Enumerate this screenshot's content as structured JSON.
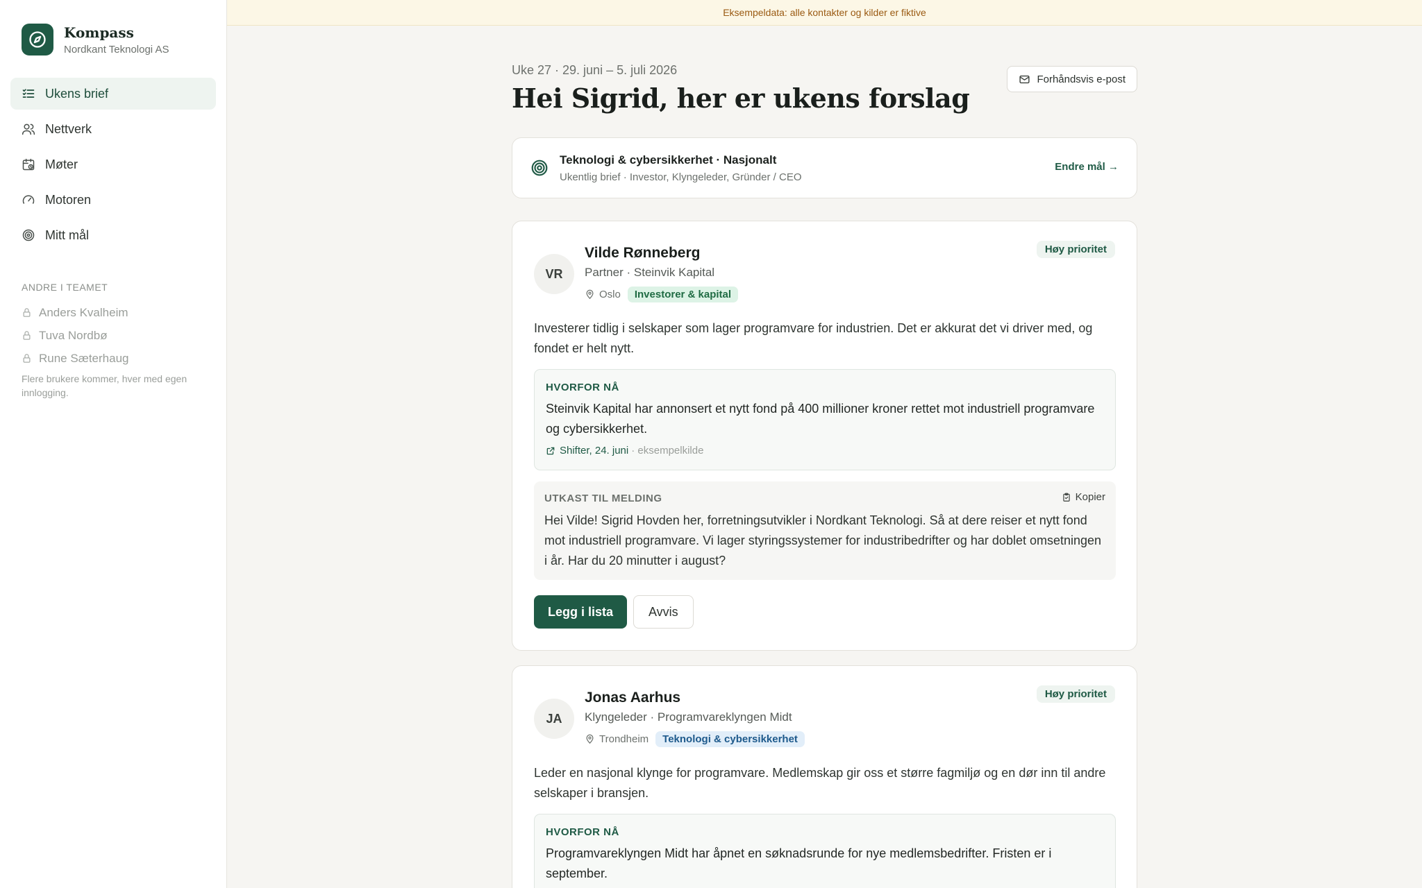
{
  "brand": {
    "name": "Kompass",
    "org": "Nordkant Teknologi AS",
    "accent": "#1f5a45"
  },
  "nav": [
    {
      "label": "Ukens brief",
      "icon": "checklist-icon",
      "active": true
    },
    {
      "label": "Nettverk",
      "icon": "users-icon",
      "active": false
    },
    {
      "label": "Møter",
      "icon": "calendar-clock-icon",
      "active": false
    },
    {
      "label": "Motoren",
      "icon": "gauge-icon",
      "active": false
    },
    {
      "label": "Mitt mål",
      "icon": "target-icon",
      "active": false
    }
  ],
  "team": {
    "label": "ANDRE I TEAMET",
    "members": [
      "Anders Kvalheim",
      "Tuva Nordbø",
      "Rune Sæterhaug"
    ],
    "note": "Flere brukere kommer, hver med egen innlogging."
  },
  "banner": "Eksempeldata: alle kontakter og kilder er fiktive",
  "header": {
    "week": "Uke 27 · 29. juni – 5. juli 2026",
    "greeting": "Hei Sigrid, her er ukens forslag",
    "preview_label": "Forhåndsvis e-post"
  },
  "goal": {
    "title": "Teknologi & cybersikkerhet · Nasjonalt",
    "subtitle": "Ukentlig brief · Investor, Klyngeleder, Gründer / CEO",
    "change_label": "Endre mål →"
  },
  "cards": [
    {
      "initials": "VR",
      "name": "Vilde Rønneberg",
      "role": "Partner · Steinvik Kapital",
      "location": "Oslo",
      "tag": "Investorer & kapital",
      "priority": "Høy prioritet",
      "description": "Investerer tidlig i selskaper som lager programvare for industrien. Det er akkurat det vi driver med, og fondet er helt nytt.",
      "why_label": "HVORFOR NÅ",
      "why_text": "Steinvik Kapital har annonsert et nytt fond på 400 millioner kroner rettet mot industriell programvare og cybersikkerhet.",
      "source": "Shifter, 24. juni",
      "source_note": "· eksempelkilde",
      "draft_label": "UTKAST TIL MELDING",
      "copy_label": "Kopier",
      "draft_text": "Hei Vilde! Sigrid Hovden her, forretningsutvikler i Nordkant Teknologi. Så at dere reiser et nytt fond mot industriell programvare. Vi lager styringssystemer for industribedrifter og har doblet omsetningen i år. Har du 20 minutter i august?",
      "add_label": "Legg i lista",
      "reject_label": "Avvis"
    },
    {
      "initials": "JA",
      "name": "Jonas Aarhus",
      "role": "Klyngeleder · Programvareklyngen Midt",
      "location": "Trondheim",
      "tag": "Teknologi & cybersikkerhet",
      "priority": "Høy prioritet",
      "description": "Leder en nasjonal klynge for programvare. Medlemskap gir oss et større fagmiljø og en dør inn til andre selskaper i bransjen.",
      "why_label": "HVORFOR NÅ",
      "why_text": "Programvareklyngen Midt har åpnet en søknadsrunde for nye medlemsbedrifter. Fristen er i september."
    }
  ]
}
